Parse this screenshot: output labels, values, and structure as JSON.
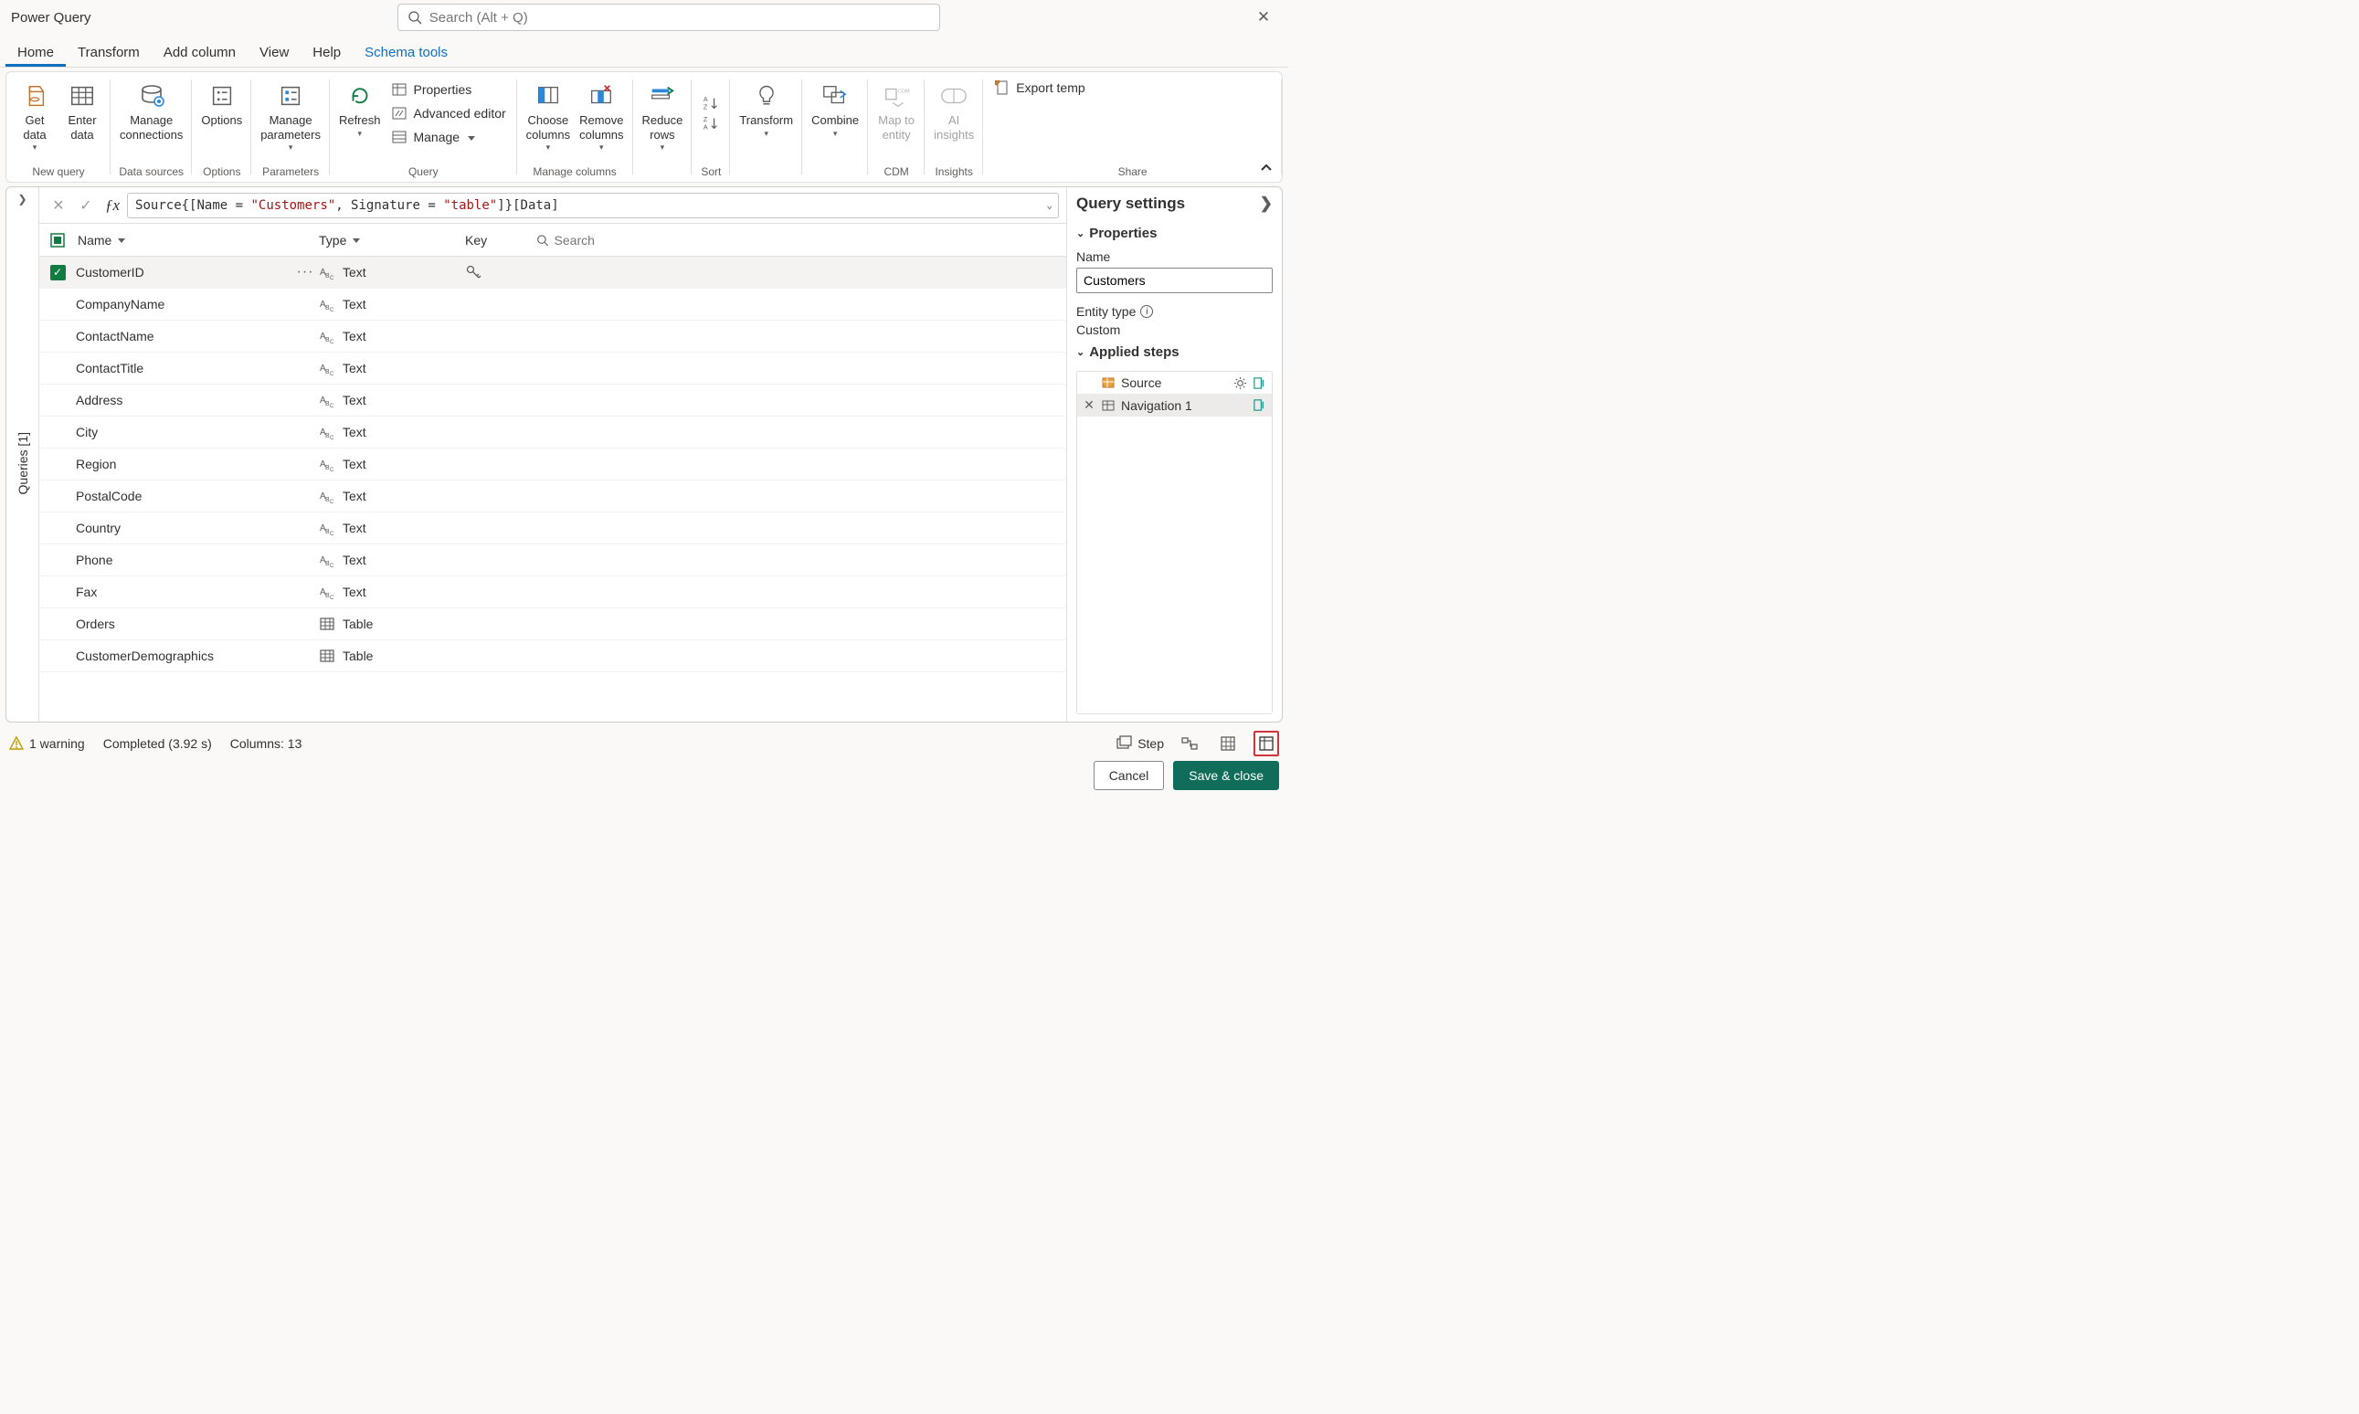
{
  "app_title": "Power Query",
  "search_placeholder": "Search (Alt + Q)",
  "tabs": {
    "home": "Home",
    "transform": "Transform",
    "add_column": "Add column",
    "view": "View",
    "help": "Help",
    "schema_tools": "Schema tools"
  },
  "ribbon": {
    "get_data": "Get\ndata",
    "enter_data": "Enter\ndata",
    "new_query": "New query",
    "manage_connections": "Manage\nconnections",
    "data_sources": "Data sources",
    "options": "Options",
    "options_group": "Options",
    "manage_parameters": "Manage\nparameters",
    "parameters": "Parameters",
    "refresh": "Refresh",
    "properties": "Properties",
    "advanced_editor": "Advanced editor",
    "manage": "Manage",
    "query": "Query",
    "choose_columns": "Choose\ncolumns",
    "remove_columns": "Remove\ncolumns",
    "manage_columns": "Manage columns",
    "reduce_rows": "Reduce\nrows",
    "sort": "Sort",
    "transform_btn": "Transform",
    "combine": "Combine",
    "map_to_entity": "Map to\nentity",
    "cdm": "CDM",
    "ai_insights": "AI\ninsights",
    "insights": "Insights",
    "export_template": "Export temp",
    "share": "Share"
  },
  "queries_rail": "Queries [1]",
  "formula_plain": "Source{[Name = \"Customers\", Signature = \"table\"]}[Data]",
  "schema_headers": {
    "name": "Name",
    "type": "Type",
    "key": "Key",
    "search_placeholder": "Search"
  },
  "schema_rows": [
    {
      "name": "CustomerID",
      "type": "Text",
      "type_kind": "text",
      "selected": true,
      "key": true
    },
    {
      "name": "CompanyName",
      "type": "Text",
      "type_kind": "text",
      "selected": false,
      "key": false
    },
    {
      "name": "ContactName",
      "type": "Text",
      "type_kind": "text",
      "selected": false,
      "key": false
    },
    {
      "name": "ContactTitle",
      "type": "Text",
      "type_kind": "text",
      "selected": false,
      "key": false
    },
    {
      "name": "Address",
      "type": "Text",
      "type_kind": "text",
      "selected": false,
      "key": false
    },
    {
      "name": "City",
      "type": "Text",
      "type_kind": "text",
      "selected": false,
      "key": false
    },
    {
      "name": "Region",
      "type": "Text",
      "type_kind": "text",
      "selected": false,
      "key": false
    },
    {
      "name": "PostalCode",
      "type": "Text",
      "type_kind": "text",
      "selected": false,
      "key": false
    },
    {
      "name": "Country",
      "type": "Text",
      "type_kind": "text",
      "selected": false,
      "key": false
    },
    {
      "name": "Phone",
      "type": "Text",
      "type_kind": "text",
      "selected": false,
      "key": false
    },
    {
      "name": "Fax",
      "type": "Text",
      "type_kind": "text",
      "selected": false,
      "key": false
    },
    {
      "name": "Orders",
      "type": "Table",
      "type_kind": "table",
      "selected": false,
      "key": false
    },
    {
      "name": "CustomerDemographics",
      "type": "Table",
      "type_kind": "table",
      "selected": false,
      "key": false
    }
  ],
  "qsettings": {
    "title": "Query settings",
    "properties": "Properties",
    "name_label": "Name",
    "name_value": "Customers",
    "entity_type_label": "Entity type",
    "entity_type_value": "Custom",
    "applied_steps": "Applied steps",
    "steps": [
      {
        "name": "Source",
        "active": false
      },
      {
        "name": "Navigation 1",
        "active": true
      }
    ]
  },
  "statusbar": {
    "warnings": "1 warning",
    "completed": "Completed (3.92 s)",
    "columns": "Columns: 13",
    "step": "Step"
  },
  "buttons": {
    "cancel": "Cancel",
    "save_close": "Save & close"
  }
}
